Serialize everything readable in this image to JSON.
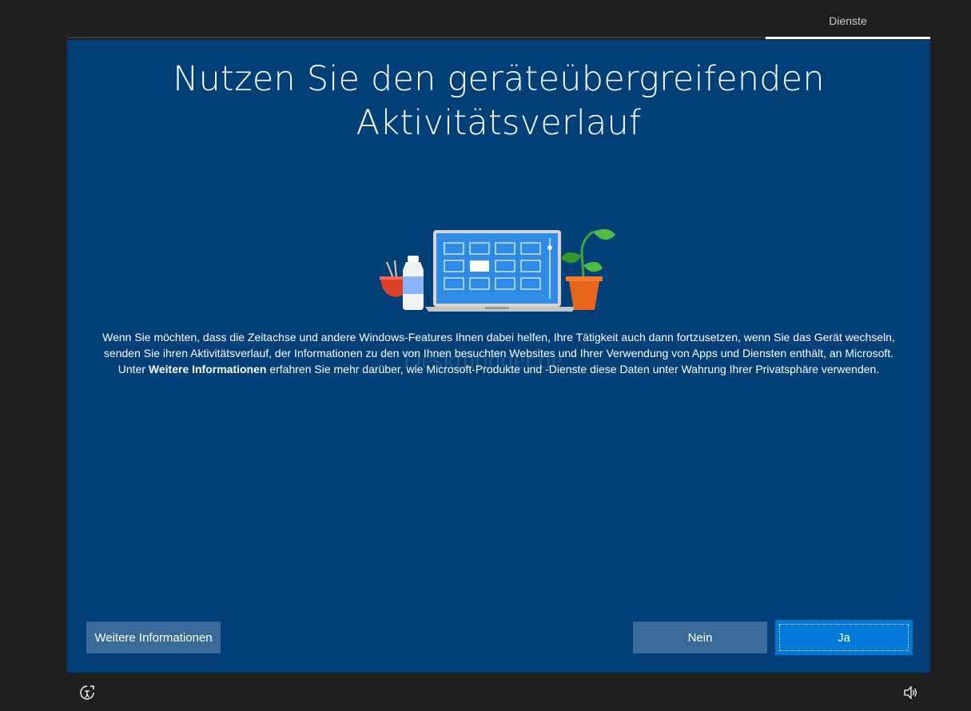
{
  "header": {
    "step_label": "Dienste"
  },
  "main": {
    "title_line1": "Nutzen Sie den geräteübergreifenden",
    "title_line2": "Aktivitätsverlauf",
    "body_part1": "Wenn Sie möchten, dass die Zeitachse und andere Windows-Features Ihnen dabei helfen, Ihre Tätigkeit auch dann fortzusetzen, wenn Sie das Gerät wechseln, senden Sie ihren Aktivitätsverlauf, der Informationen zu den von Ihnen besuchten Websites und Ihrer Verwendung von Apps und Diensten enthält, an Microsoft. Unter ",
    "body_bold": "Weitere Informationen",
    "body_part2": " erfahren Sie mehr darüber, wie Microsoft-Produkte und -Dienste diese Daten unter Wahrung Ihrer Privatsphäre verwenden.",
    "watermark": "Deskmodder.de"
  },
  "buttons": {
    "more_info": "Weitere Informationen",
    "no": "Nein",
    "yes": "Ja"
  },
  "icons": {
    "accessibility": "accessibility-icon",
    "volume": "volume-icon"
  },
  "colors": {
    "panel_bg": "#003f78",
    "page_bg": "#1f1f1f",
    "primary_button": "#0078d7",
    "secondary_button": "#3a6a97"
  }
}
